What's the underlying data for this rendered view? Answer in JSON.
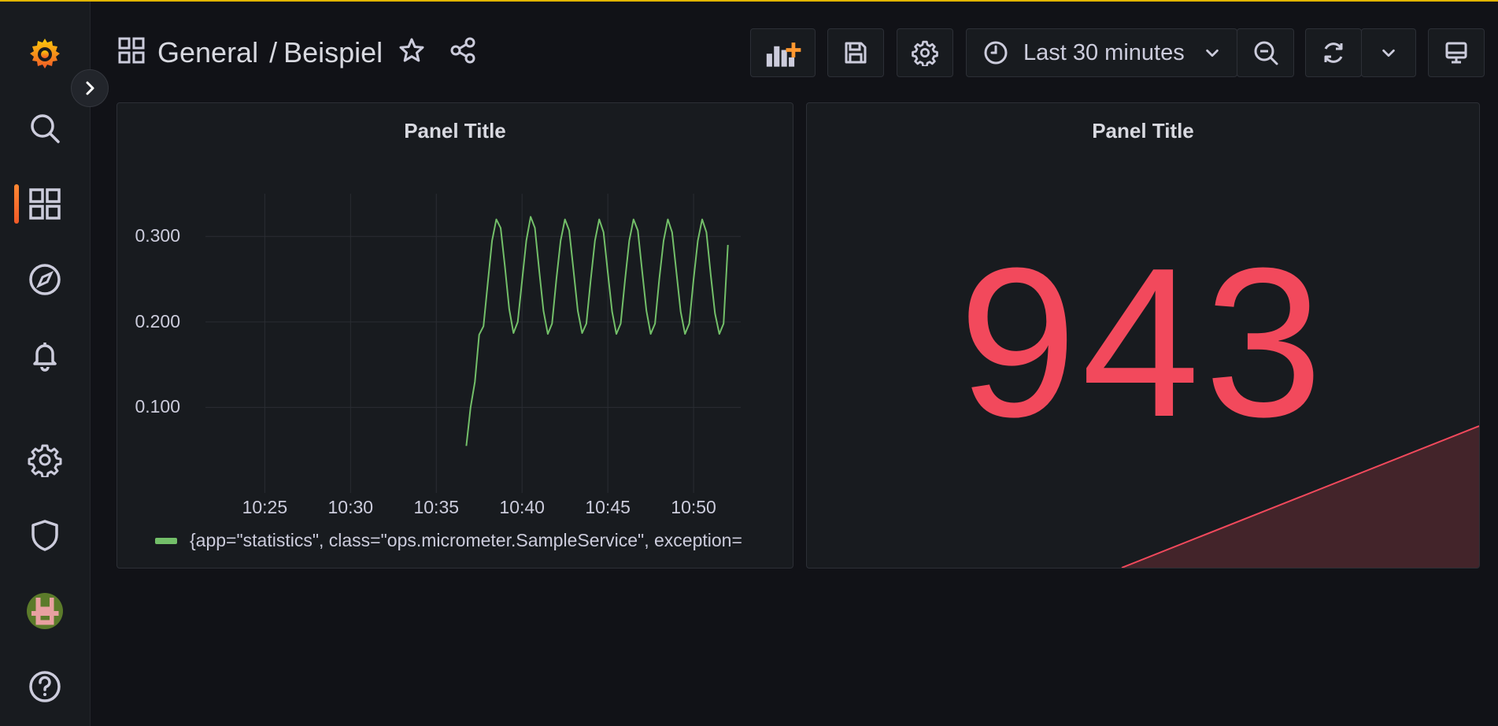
{
  "breadcrumb": {
    "folder": "General",
    "separator": "/",
    "dashboard": "Beispiel"
  },
  "toolbar": {
    "time_range": "Last 30 minutes"
  },
  "panels": [
    {
      "title": "Panel Title",
      "legend": "{app=\"statistics\", class=\"ops.micrometer.SampleService\", exception=",
      "series_color": "#73bf69"
    },
    {
      "title": "Panel Title",
      "value": "943",
      "value_color": "#f2495c"
    }
  ],
  "chart_data": {
    "type": "line",
    "title": "Panel Title",
    "xlabel": "",
    "ylabel": "",
    "x_ticks": [
      "10:25",
      "10:30",
      "10:35",
      "10:40",
      "10:45",
      "10:50"
    ],
    "y_ticks": [
      "0.100",
      "0.200",
      "0.300"
    ],
    "ylim": [
      0,
      0.35
    ],
    "grid": true,
    "legend": "bottom",
    "series": [
      {
        "name": "{app=\"statistics\", class=\"ops.micrometer.SampleService\", exception=",
        "color": "#73bf69",
        "x": [
          "10:36:45",
          "10:37:00",
          "10:37:15",
          "10:37:30",
          "10:37:45",
          "10:38:00",
          "10:38:15",
          "10:38:30",
          "10:38:45",
          "10:39:00",
          "10:39:15",
          "10:39:30",
          "10:39:45",
          "10:40:00",
          "10:40:15",
          "10:40:30",
          "10:40:45",
          "10:41:00",
          "10:41:15",
          "10:41:30",
          "10:41:45",
          "10:42:00",
          "10:42:15",
          "10:42:30",
          "10:42:45",
          "10:43:00",
          "10:43:15",
          "10:43:30",
          "10:43:45",
          "10:44:00",
          "10:44:15",
          "10:44:30",
          "10:44:45",
          "10:45:00",
          "10:45:15",
          "10:45:30",
          "10:45:45",
          "10:46:00",
          "10:46:15",
          "10:46:30",
          "10:46:45",
          "10:47:00",
          "10:47:15",
          "10:47:30",
          "10:47:45",
          "10:48:00",
          "10:48:15",
          "10:48:30",
          "10:48:45",
          "10:49:00",
          "10:49:15",
          "10:49:30",
          "10:49:45",
          "10:50:00",
          "10:50:15",
          "10:50:30",
          "10:50:45",
          "10:51:00",
          "10:51:15",
          "10:51:30",
          "10:51:45",
          "10:52:00"
        ],
        "values": [
          0.055,
          0.1,
          0.13,
          0.185,
          0.195,
          0.245,
          0.295,
          0.32,
          0.31,
          0.265,
          0.215,
          0.187,
          0.2,
          0.248,
          0.295,
          0.323,
          0.31,
          0.26,
          0.213,
          0.186,
          0.198,
          0.25,
          0.295,
          0.32,
          0.307,
          0.26,
          0.213,
          0.187,
          0.198,
          0.248,
          0.295,
          0.32,
          0.305,
          0.258,
          0.212,
          0.186,
          0.198,
          0.248,
          0.295,
          0.32,
          0.307,
          0.26,
          0.213,
          0.186,
          0.198,
          0.25,
          0.295,
          0.32,
          0.305,
          0.258,
          0.212,
          0.186,
          0.198,
          0.25,
          0.295,
          0.32,
          0.305,
          0.255,
          0.21,
          0.186,
          0.198,
          0.29
        ]
      }
    ]
  },
  "stat_sparkline": {
    "values": [
      0,
      1
    ],
    "color": "#f2495c"
  }
}
